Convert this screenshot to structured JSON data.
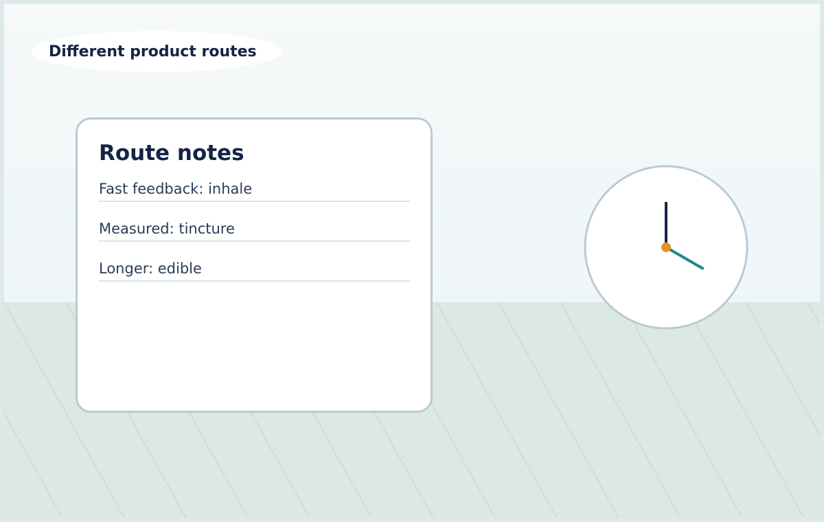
{
  "title": "Different product routes",
  "card": {
    "heading": "Route notes",
    "notes": [
      "Fast feedback: inhale",
      "Measured: tincture",
      "Longer: edible"
    ]
  },
  "clock": {
    "hour": 4,
    "minute": 0
  },
  "colors": {
    "text_dark": "#142544",
    "hand_minute": "#142544",
    "hand_hour": "#1a8a84",
    "center_dot": "#e8902a",
    "card_border": "#b9cbd3",
    "floor": "#dce8e4"
  }
}
